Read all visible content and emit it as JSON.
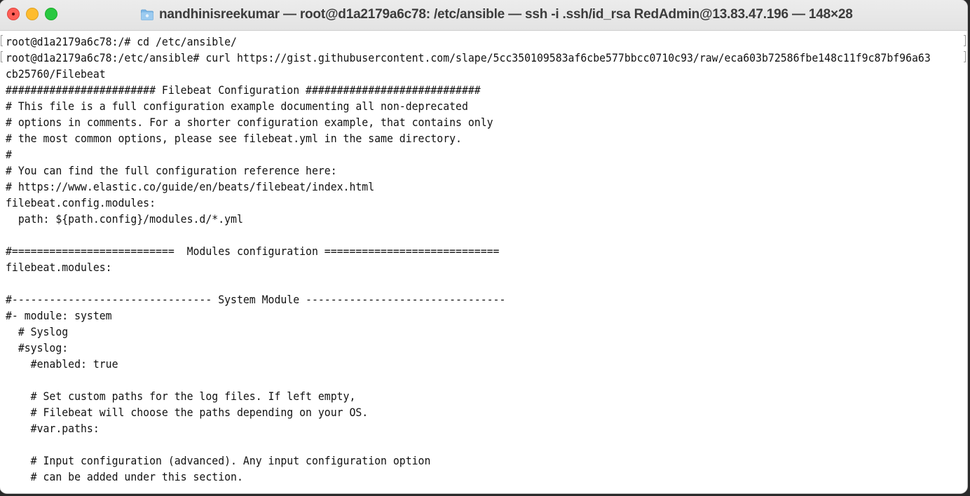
{
  "window": {
    "title": "nandhinisreekumar — root@d1a2179a6c78: /etc/ansible — ssh -i .ssh/id_rsa RedAdmin@13.83.47.196 — 148×28"
  },
  "terminal": {
    "lines": [
      "root@d1a2179a6c78:/# cd /etc/ansible/",
      "root@d1a2179a6c78:/etc/ansible# curl https://gist.githubusercontent.com/slape/5cc350109583af6cbe577bbcc0710c93/raw/eca603b72586fbe148c11f9c87bf96a63",
      "cb25760/Filebeat",
      "######################## Filebeat Configuration ############################",
      "# This file is a full configuration example documenting all non-deprecated",
      "# options in comments. For a shorter configuration example, that contains only",
      "# the most common options, please see filebeat.yml in the same directory.",
      "#",
      "# You can find the full configuration reference here:",
      "# https://www.elastic.co/guide/en/beats/filebeat/index.html",
      "filebeat.config.modules:",
      "  path: ${path.config}/modules.d/*.yml",
      "",
      "#==========================  Modules configuration ============================",
      "filebeat.modules:",
      "",
      "#-------------------------------- System Module --------------------------------",
      "#- module: system",
      "  # Syslog",
      "  #syslog:",
      "    #enabled: true",
      "",
      "    # Set custom paths for the log files. If left empty,",
      "    # Filebeat will choose the paths depending on your OS.",
      "    #var.paths:",
      "",
      "    # Input configuration (advanced). Any input configuration option",
      "    # can be added under this section."
    ]
  },
  "colors": {
    "close": "#fe5f57",
    "minimize": "#febc2e",
    "zoom": "#28c840",
    "folder": "#7cb7e6",
    "text": "#111111",
    "background": "#ffffff"
  },
  "icons": {
    "folder": "folder-icon"
  }
}
